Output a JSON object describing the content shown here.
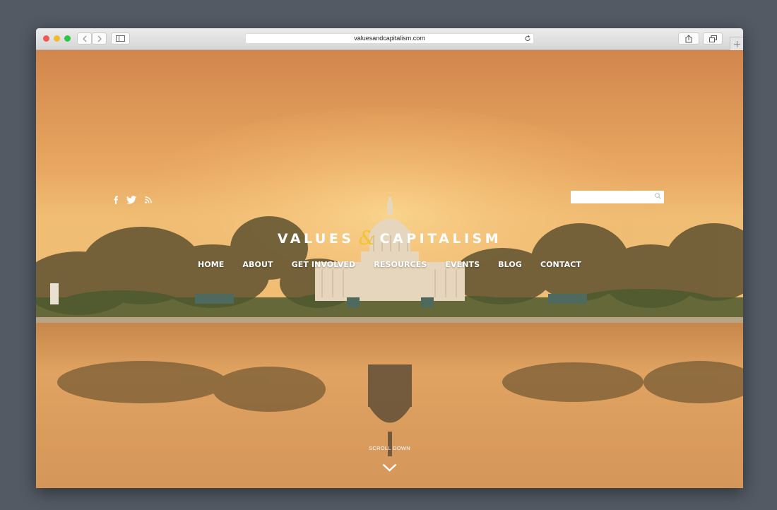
{
  "browser": {
    "url": "valuesandcapitalism.com",
    "icons": [
      "back-icon",
      "forward-icon",
      "sidebar-icon",
      "reload-icon",
      "share-icon",
      "tabs-icon",
      "new-tab-icon"
    ]
  },
  "site": {
    "logo": {
      "word1": "VALUES",
      "ampersand": "&",
      "word2": "CAPITALISM"
    },
    "social": [
      "facebook-icon",
      "twitter-icon",
      "rss-icon"
    ],
    "search": {
      "value": "",
      "placeholder": ""
    },
    "nav": [
      "HOME",
      "ABOUT",
      "GET INVOLVED",
      "RESOURCES",
      "EVENTS",
      "BLOG",
      "CONTACT"
    ],
    "scroll_label": "SCROLL DOWN"
  },
  "colors": {
    "sky_top": "#d58b50",
    "sky_glow": "#f1be74",
    "accent_ampersand": "#f1c232"
  }
}
